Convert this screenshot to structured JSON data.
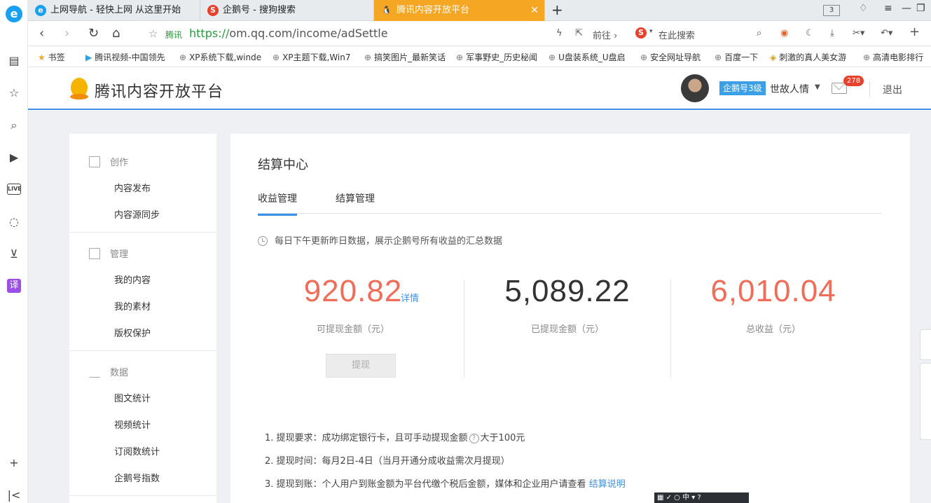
{
  "browser": {
    "tabs": [
      {
        "title": "上网导航 - 轻快上网 从这里开始",
        "icon": "e"
      },
      {
        "title": "企鹅号 - 搜狗搜索",
        "icon": "S"
      },
      {
        "title": "腾讯内容开放平台",
        "icon": "🐧"
      }
    ],
    "tab_count": "3",
    "url_site": "腾讯",
    "url_scheme": "https://",
    "url_rest": "om.qq.com/income/adSettle",
    "forward_label": "前往",
    "search_placeholder": "在此搜索",
    "bookmarks_label": "书签",
    "bookmarks": [
      "腾讯视频-中国领先",
      "XP系统下载,winde",
      "XP主题下载,Win7",
      "搞笑图片_最新笑话",
      "军事野史_历史秘闻",
      "U盘装系统_U盘启",
      "安全网址导航",
      "百度一下",
      "刺激的真人美女游",
      "高清电影排行"
    ]
  },
  "header": {
    "logo_text": "腾讯内容开放平台",
    "level_badge": "企鹅号3级",
    "username": "世故人情",
    "mail_count": "278",
    "logout": "退出"
  },
  "sidebar": {
    "groups": [
      {
        "title": "创作",
        "items": [
          "内容发布",
          "内容源同步"
        ]
      },
      {
        "title": "管理",
        "items": [
          "我的内容",
          "我的素材",
          "版权保护"
        ]
      },
      {
        "title": "数据",
        "items": [
          "图文统计",
          "视频统计",
          "订阅数统计",
          "企鹅号指数"
        ]
      }
    ]
  },
  "main": {
    "title": "结算中心",
    "tabs": [
      "收益管理",
      "结算管理"
    ],
    "notice": "每日下午更新昨日数据，展示企鹅号所有收益的汇总数据",
    "stats": [
      {
        "value": "920.82",
        "label": "可提现金额（元）",
        "color": "#f06d5a"
      },
      {
        "value": "5,089.22",
        "label": "已提现金额（元）",
        "color": "#333333"
      },
      {
        "value": "6,010.04",
        "label": "总收益（元）",
        "color": "#f06d5a"
      }
    ],
    "detail_link": "详情",
    "withdraw_button": "提现",
    "rules": {
      "r1_a": "1. 提现要求：成功绑定银行卡，且可手动提现金额",
      "r1_b": "大于100元",
      "r2": "2. 提现时间：每月2日-4日（当月开通分成收益需次月提现）",
      "r3_a": "3. 提现到账：个人用户到账金额为平台代缴个税后金额，媒体和企业用户请查看",
      "r3_link": "结算说明"
    }
  },
  "colors": {
    "accent": "#3c91e6",
    "highlight_number": "#f06d5a",
    "active_tab": "#f5a623"
  },
  "ime_text": "中"
}
